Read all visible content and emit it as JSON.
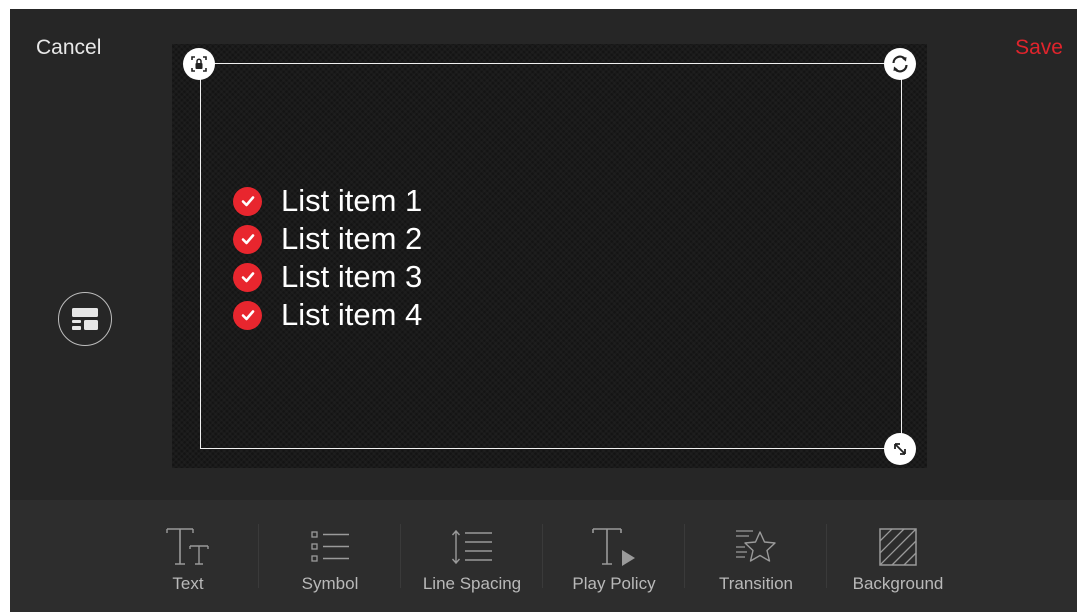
{
  "header": {
    "cancel_label": "Cancel",
    "save_label": "Save"
  },
  "editor": {
    "items": [
      {
        "label": "List item 1",
        "icon": "check-circle-icon"
      },
      {
        "label": "List item 2",
        "icon": "check-circle-icon"
      },
      {
        "label": "List item 3",
        "icon": "check-circle-icon"
      },
      {
        "label": "List item 4",
        "icon": "check-circle-icon"
      }
    ],
    "handles": [
      "lock-icon",
      "rotate-icon",
      "resize-icon"
    ]
  },
  "toolbar": {
    "tools": [
      {
        "label": "Text",
        "icon": "text-size-icon"
      },
      {
        "label": "Symbol",
        "icon": "bullet-list-icon"
      },
      {
        "label": "Line Spacing",
        "icon": "line-spacing-icon"
      },
      {
        "label": "Play Policy",
        "icon": "play-policy-icon"
      },
      {
        "label": "Transition",
        "icon": "star-transition-icon"
      },
      {
        "label": "Background",
        "icon": "background-pattern-icon"
      }
    ]
  },
  "colors": {
    "accent": "#e0242c",
    "app_background": "#262626",
    "toolbar_background": "#2d2d2d"
  }
}
